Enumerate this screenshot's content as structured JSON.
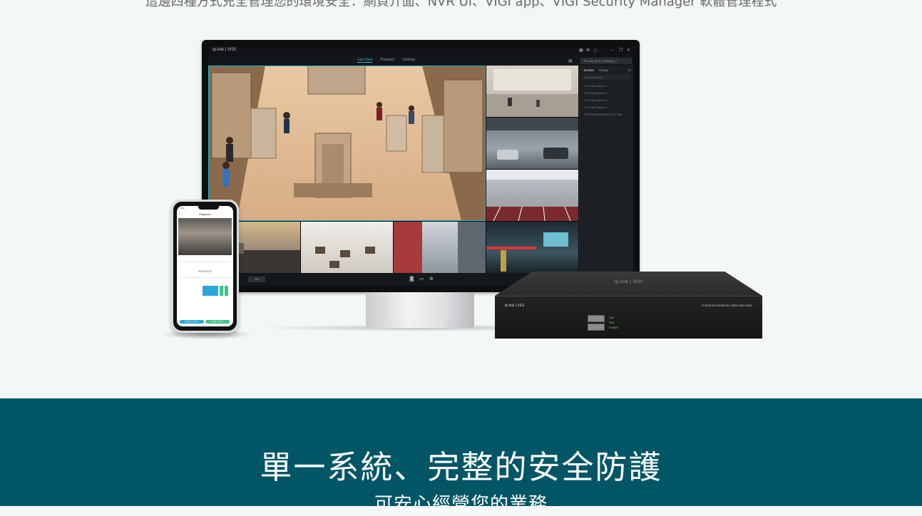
{
  "intro": {
    "text": "這邊四種方式充全管理您的環境安全：網頁介面、NVR UI、VIGI app、VIGI Security Manager 軟體管理程式"
  },
  "vms": {
    "brand": "tp-link | VIGI",
    "tabs": [
      "Live View",
      "Playback",
      "Settings"
    ],
    "active_tab": "Live View",
    "site_select": "TP-Link_5521_Tunnel(1) ˅",
    "panel_tabs": [
      "Device",
      "Group"
    ],
    "search_placeholder": "Device Name",
    "devices": [
      "TP-Link Camera 1",
      "TP-Link Camera 2",
      "TP-Link Camera 3",
      "TP-Link Camera 4",
      "VIGI NVR1008H(8CH) 1/2  8/8"
    ],
    "layout_label": "1/4",
    "bottom_icons": [
      "camera-icon",
      "record-icon",
      "zoom-icon"
    ]
  },
  "phone": {
    "time": "9:41",
    "title": "Playback",
    "date": "2019-10-22",
    "btn_a": "Search device",
    "btn_b": "Share video"
  },
  "nvr": {
    "top_brand": "tp-link | VIGI",
    "front_brand": "tp-link | VIGI",
    "model": "8 Channel Network Video Recorder",
    "leds": [
      "LAN",
      "HDD",
      "POWER"
    ]
  },
  "section": {
    "title": "單一系統、完整的安全防護",
    "subtitle": "可安心經營您的業務"
  },
  "colors": {
    "teal": "#015666",
    "accent": "#23b6d8"
  }
}
